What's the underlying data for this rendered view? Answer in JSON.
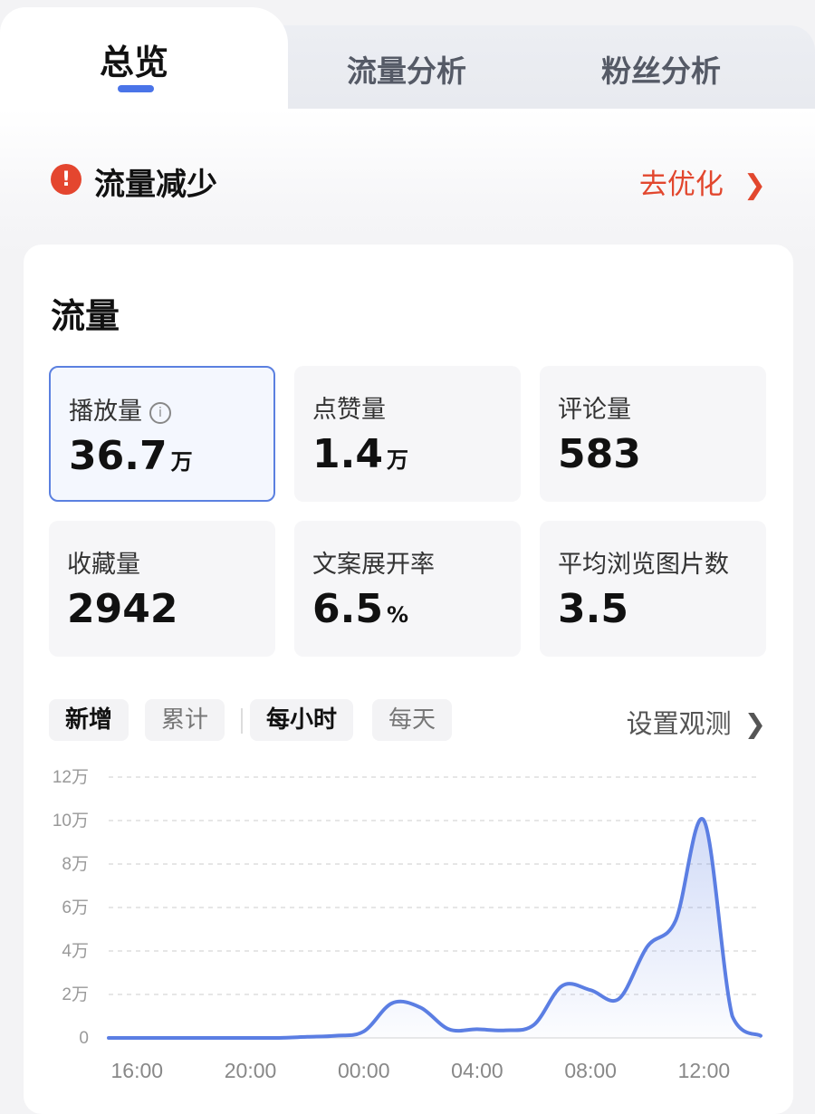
{
  "tabs": [
    {
      "label": "总览",
      "active": true
    },
    {
      "label": "流量分析",
      "active": false
    },
    {
      "label": "粉丝分析",
      "active": false
    }
  ],
  "alert": {
    "icon": "exclamation-icon",
    "text": "流量减少",
    "action": "去优化",
    "action_icon": "chevron-right-icon"
  },
  "section": {
    "title": "流量"
  },
  "metrics": [
    {
      "label": "播放量",
      "value": "36.7",
      "unit": "万",
      "selected": true,
      "info_icon": true
    },
    {
      "label": "点赞量",
      "value": "1.4",
      "unit": "万"
    },
    {
      "label": "评论量",
      "value": "583",
      "unit": ""
    },
    {
      "label": "收藏量",
      "value": "2942",
      "unit": ""
    },
    {
      "label": "文案展开率",
      "value": "6.5",
      "unit": "%"
    },
    {
      "label": "平均浏览图片数",
      "value": "3.5",
      "unit": ""
    }
  ],
  "filters": {
    "mode": [
      {
        "label": "新增",
        "active": true
      },
      {
        "label": "累计",
        "active": false
      }
    ],
    "granularity": [
      {
        "label": "每小时",
        "active": true
      },
      {
        "label": "每天",
        "active": false
      }
    ],
    "observe": "设置观测"
  },
  "colors": {
    "accent": "#4a74e8",
    "alert": "#e4462f",
    "line": "#5b7ee3"
  },
  "chart_data": {
    "type": "area",
    "ylim": [
      0,
      120000
    ],
    "yticks": [
      {
        "value": 0,
        "label": "0"
      },
      {
        "value": 20000,
        "label": "2万"
      },
      {
        "value": 40000,
        "label": "4万"
      },
      {
        "value": 60000,
        "label": "6万"
      },
      {
        "value": 80000,
        "label": "8万"
      },
      {
        "value": 100000,
        "label": "10万"
      },
      {
        "value": 120000,
        "label": "12万"
      }
    ],
    "xticks": [
      "16:00",
      "20:00",
      "00:00",
      "04:00",
      "08:00",
      "12:00"
    ],
    "grid": true,
    "series": [
      {
        "x": [
          "15:00",
          "16:00",
          "17:00",
          "18:00",
          "19:00",
          "20:00",
          "21:00",
          "22:00",
          "23:00",
          "00:00",
          "01:00",
          "02:00",
          "03:00",
          "04:00",
          "05:00",
          "06:00",
          "07:00",
          "08:00",
          "09:00",
          "10:00",
          "11:00",
          "12:00",
          "13:00",
          "14:00"
        ],
        "values": [
          0,
          0,
          0,
          0,
          0,
          0,
          0,
          500,
          1000,
          3000,
          16000,
          14000,
          4000,
          4000,
          3500,
          6000,
          24000,
          22000,
          18000,
          42000,
          54000,
          100000,
          10000,
          1000
        ]
      }
    ]
  }
}
